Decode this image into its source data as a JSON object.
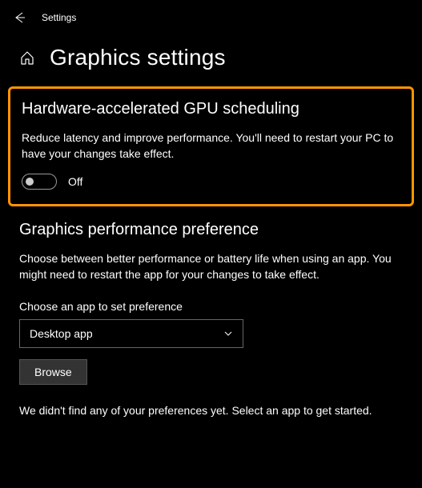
{
  "topbar": {
    "title": "Settings"
  },
  "header": {
    "title": "Graphics settings"
  },
  "gpu_section": {
    "title": "Hardware-accelerated GPU scheduling",
    "description": "Reduce latency and improve performance. You'll need to restart your PC to have your changes take effect.",
    "toggle_state": "Off"
  },
  "perf_section": {
    "title": "Graphics performance preference",
    "description": "Choose between better performance or battery life when using an app. You might need to restart the app for your changes to take effect.",
    "choose_label": "Choose an app to set preference",
    "selected_option": "Desktop app",
    "browse_label": "Browse"
  },
  "footer": {
    "text": "We didn't find any of your preferences yet. Select an app to get started."
  }
}
